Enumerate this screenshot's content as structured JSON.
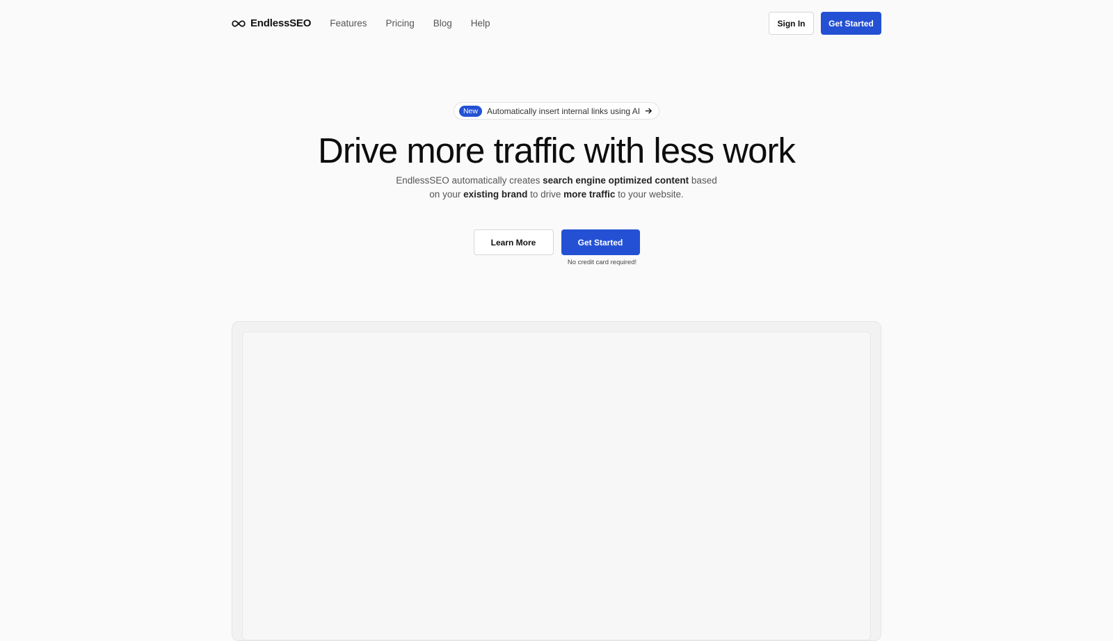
{
  "brand": {
    "name": "EndlessSEO",
    "icon": "infinity-icon"
  },
  "nav": {
    "links": [
      "Features",
      "Pricing",
      "Blog",
      "Help"
    ],
    "sign_in": "Sign In",
    "get_started": "Get Started"
  },
  "announcement": {
    "badge": "New",
    "text": "Automatically insert internal links using AI",
    "icon": "arrow-right-icon"
  },
  "hero": {
    "headline": "Drive more traffic with less work",
    "sub": {
      "p1": "EndlessSEO automatically creates ",
      "b1": "search engine optimized content",
      "p2": " based on your ",
      "b2": "existing brand",
      "p3": " to drive ",
      "b3": "more traffic",
      "p4": " to your website."
    }
  },
  "cta": {
    "learn_more": "Learn More",
    "get_started": "Get Started",
    "note": "No credit card required!"
  },
  "colors": {
    "accent": "#2451d4",
    "background": "#fafafa"
  }
}
